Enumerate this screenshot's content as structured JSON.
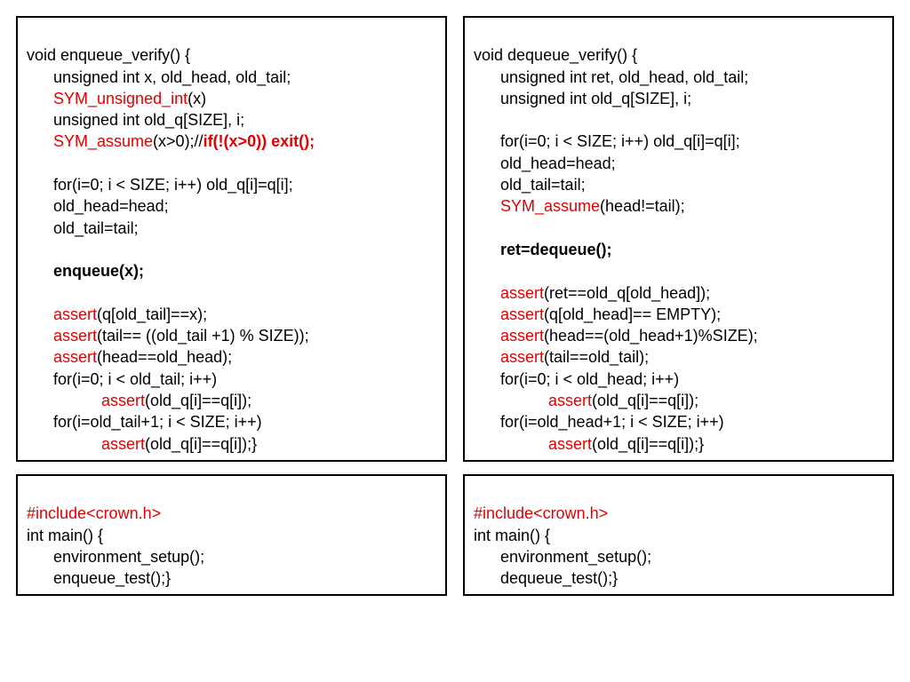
{
  "panel1": {
    "l1a": "void enqueue_verify() {",
    "l2a": "unsigned int x, old_head, old_tail;",
    "l3a": "SYM_unsigned_int",
    "l3b": "(x)",
    "l4a": "unsigned int old_q[SIZE], i;",
    "l5a": "SYM_assume",
    "l5b": "(x>0);//",
    "l5c": "if(!(x>0)) exit();",
    "l6a": " ",
    "l7a": "for(i=0; i < SIZE; i++) old_q[i]=q[i];",
    "l8a": "old_head=head;",
    "l9a": "old_tail=tail;",
    "l10a": " ",
    "l11a": "enqueue(x);",
    "l12a": " ",
    "l13a": "assert",
    "l13b": "(q[old_tail]==x);",
    "l14a": "assert",
    "l14b": "(tail== ((old_tail +1) % SIZE));",
    "l15a": "assert",
    "l15b": "(head==old_head);",
    "l16a": "for(i=0; i < old_tail; i++)",
    "l17a": "assert",
    "l17b": "(old_q[i]==q[i]);",
    "l18a": "for(i=old_tail+1; i < SIZE; i++)",
    "l19a": "assert",
    "l19b": "(old_q[i]==q[i]);}"
  },
  "panel2": {
    "l1a": "void dequeue_verify() {",
    "l2a": "unsigned int ret, old_head, old_tail;",
    "l3a": "unsigned int old_q[SIZE], i;",
    "l4a": " ",
    "l5a": "for(i=0; i < SIZE; i++) old_q[i]=q[i];",
    "l6a": "old_head=head;",
    "l7a": "old_tail=tail;",
    "l8a": "SYM_assume",
    "l8b": "(head!=tail);",
    "l9a": " ",
    "l10a": "ret=dequeue();",
    "l11a": " ",
    "l12a": "assert",
    "l12b": "(ret==old_q[old_head]);",
    "l13a": "assert",
    "l13b": "(q[old_head]== EMPTY);",
    "l14a": "assert",
    "l14b": "(head==(old_head+1)%SIZE);",
    "l15a": "assert",
    "l15b": "(tail==old_tail);",
    "l16a": "for(i=0; i < old_head; i++)",
    "l17a": "assert",
    "l17b": "(old_q[i]==q[i]);",
    "l18a": "for(i=old_head+1; i < SIZE; i++)",
    "l19a": "assert",
    "l19b": "(old_q[i]==q[i]);}"
  },
  "panel3": {
    "l1a": "#include<crown.h>",
    "l2a": "int main() {",
    "l3a": "environment_setup();",
    "l4a": "enqueue_test();}"
  },
  "panel4": {
    "l1a": "#include<crown.h>",
    "l2a": "int main() {",
    "l3a": "environment_setup();",
    "l4a": "dequeue_test();}"
  }
}
